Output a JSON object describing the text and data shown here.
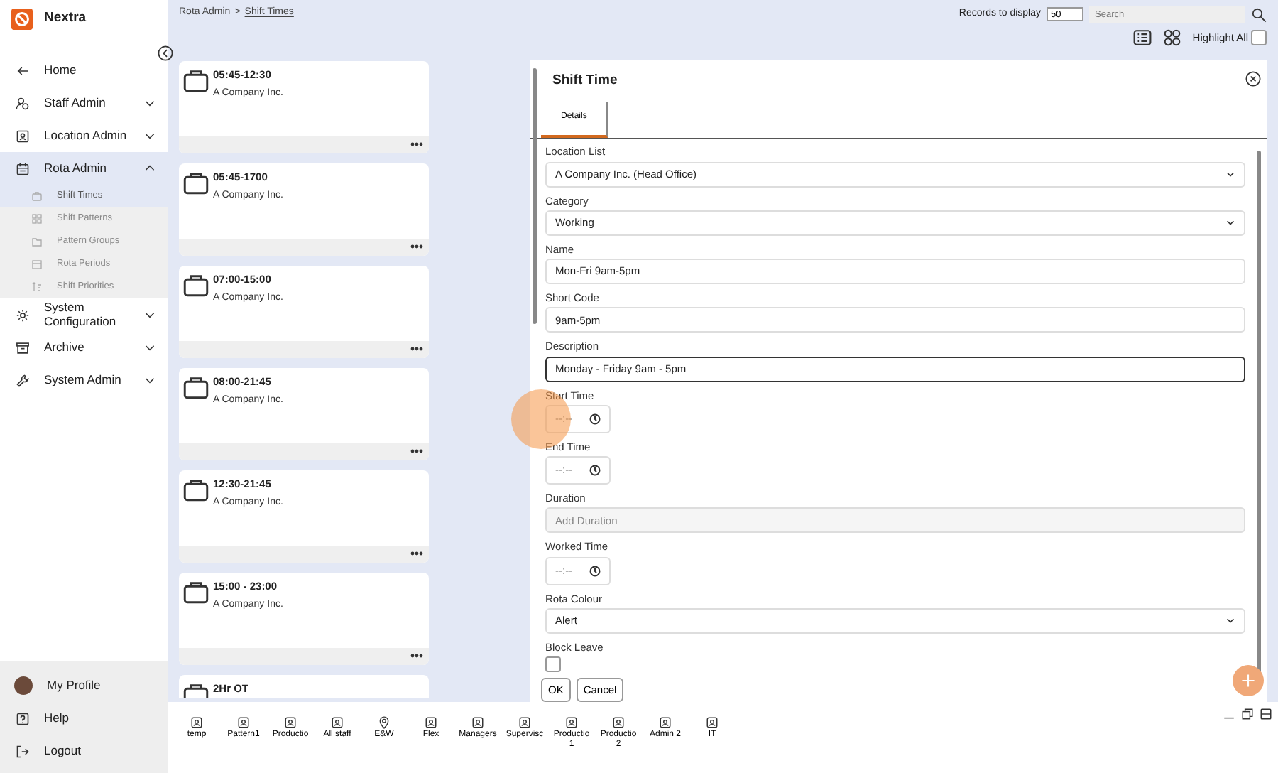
{
  "app": {
    "name": "Nextra"
  },
  "sidebar": {
    "items": [
      {
        "label": "Home",
        "selected": false
      },
      {
        "label": "Staff Admin",
        "expanded": false,
        "selected": false
      },
      {
        "label": "Location Admin",
        "expanded": false,
        "selected": false
      },
      {
        "label": "Rota Admin",
        "expanded": true,
        "selected": true,
        "children": [
          {
            "label": "Shift Times",
            "selected": true
          },
          {
            "label": "Shift Patterns",
            "selected": false
          },
          {
            "label": "Pattern Groups",
            "selected": false
          },
          {
            "label": "Rota Periods",
            "selected": false
          },
          {
            "label": "Shift Priorities",
            "selected": false
          }
        ]
      },
      {
        "label": "System Configuration",
        "expanded": false,
        "selected": false
      },
      {
        "label": "Archive",
        "expanded": false,
        "selected": false
      },
      {
        "label": "System Admin",
        "expanded": false,
        "selected": false
      }
    ],
    "footer": [
      {
        "label": "My Profile"
      },
      {
        "label": "Help"
      },
      {
        "label": "Logout"
      }
    ]
  },
  "breadcrumb": {
    "parent": "Rota Admin",
    "separator": ">",
    "current": "Shift Times"
  },
  "toolbar": {
    "records_label": "Records to display",
    "records_value": "50",
    "search_placeholder": "Search",
    "highlight_label": "Highlight All",
    "highlight_checked": false
  },
  "shifts": [
    {
      "title": "05:45-12:30",
      "company": "A Company Inc."
    },
    {
      "title": "05:45-1700",
      "company": "A Company Inc."
    },
    {
      "title": "07:00-15:00",
      "company": "A Company Inc."
    },
    {
      "title": "08:00-21:45",
      "company": "A Company Inc."
    },
    {
      "title": "12:30-21:45",
      "company": "A Company Inc."
    },
    {
      "title": "15:00 - 23:00",
      "company": "A Company Inc."
    },
    {
      "title": "2Hr OT"
    }
  ],
  "panel": {
    "title": "Shift Time",
    "tabs": [
      {
        "label": "Details",
        "selected": true
      }
    ],
    "fields": [
      {
        "kind": "select",
        "label": "Location List",
        "value": "A Company Inc. (Head Office)"
      },
      {
        "kind": "select",
        "label": "Category",
        "value": "Working"
      },
      {
        "kind": "text",
        "label": "Name",
        "value": "Mon-Fri 9am-5pm"
      },
      {
        "kind": "text",
        "label": "Short Code",
        "value": "9am-5pm"
      },
      {
        "kind": "text",
        "label": "Description",
        "value": "Monday - Friday 9am - 5pm",
        "focused": true
      },
      {
        "kind": "time",
        "label": "Start Time",
        "placeholder": "--:--"
      },
      {
        "kind": "time",
        "label": "End Time",
        "placeholder": "--:--"
      },
      {
        "kind": "text",
        "label": "Duration",
        "placeholder": "Add Duration",
        "disabled": true
      },
      {
        "kind": "time",
        "label": "Worked Time",
        "placeholder": "--:--"
      },
      {
        "kind": "select",
        "label": "Rota Colour",
        "value": "Alert"
      },
      {
        "kind": "checkbox",
        "label": "Block Leave",
        "checked": false
      }
    ],
    "buttons": [
      "OK",
      "Cancel"
    ]
  },
  "tray": [
    {
      "label": "temp",
      "kind": "group"
    },
    {
      "label": "Pattern1",
      "kind": "group"
    },
    {
      "label": "Productio",
      "kind": "group"
    },
    {
      "label": "All staff",
      "kind": "group"
    },
    {
      "label": "E&W",
      "kind": "location"
    },
    {
      "label": "Flex",
      "kind": "group"
    },
    {
      "label": "Managers",
      "kind": "group"
    },
    {
      "label": "Supervisc",
      "kind": "group"
    },
    {
      "label": "Productio 1",
      "kind": "group"
    },
    {
      "label": "Productio 2",
      "kind": "group"
    },
    {
      "label": "Admin 2",
      "kind": "group"
    },
    {
      "label": "IT",
      "kind": "group"
    }
  ]
}
